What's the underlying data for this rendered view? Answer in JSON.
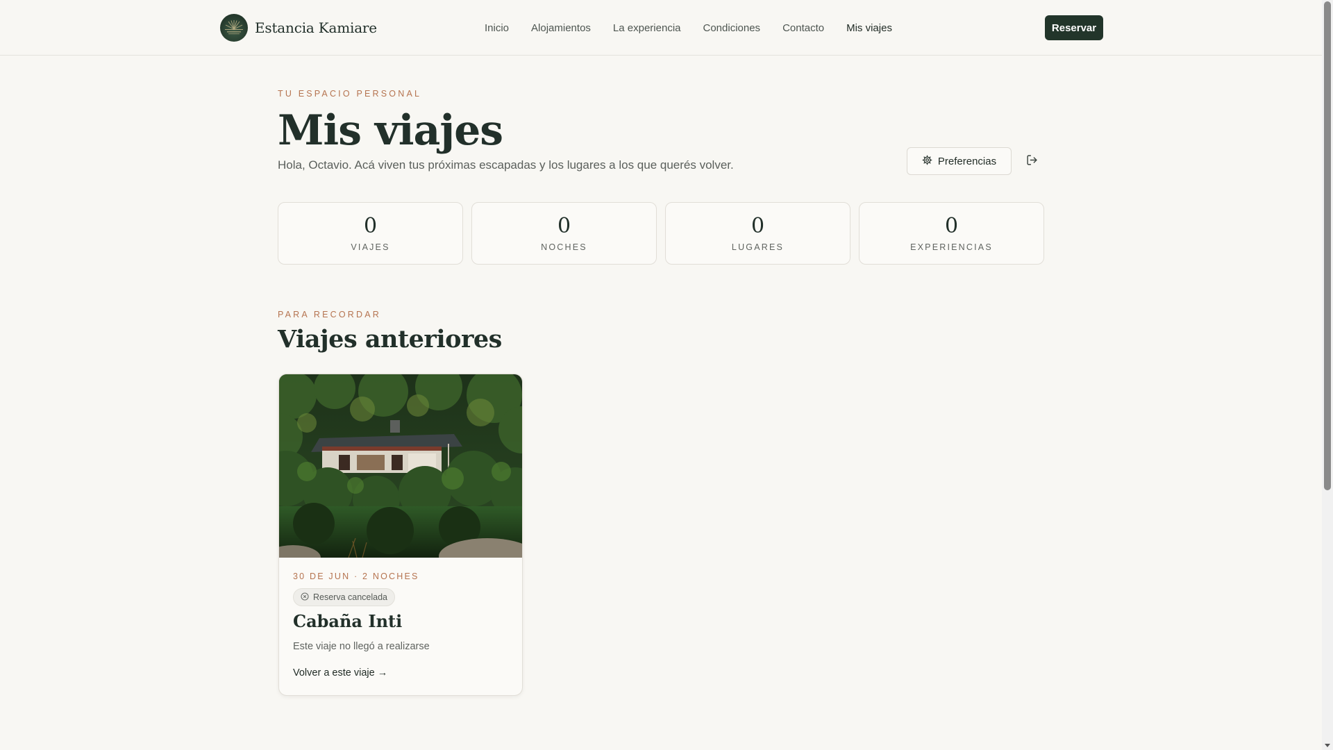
{
  "brand": {
    "name": "Estancia Kamiare",
    "logo_icon": "sun-horizon-logo-icon"
  },
  "nav": {
    "items": [
      {
        "label": "Inicio"
      },
      {
        "label": "Alojamientos"
      },
      {
        "label": "La experiencia"
      },
      {
        "label": "Condiciones"
      },
      {
        "label": "Contacto"
      },
      {
        "label": "Mis viajes",
        "active": true
      }
    ],
    "cta_label": "Reservar"
  },
  "intro": {
    "eyebrow": "TU ESPACIO PERSONAL",
    "title": "Mis viajes",
    "greeting": "Hola, Octavio. Acá viven tus próximas escapadas y los lugares a los que querés volver.",
    "preferences_label": "Preferencias",
    "preferences_icon": "gear-icon",
    "logout_icon": "logout-icon"
  },
  "stats": [
    {
      "value": "0",
      "label": "VIAJES"
    },
    {
      "value": "0",
      "label": "NOCHES"
    },
    {
      "value": "0",
      "label": "LUGARES"
    },
    {
      "value": "0",
      "label": "EXPERIENCIAS"
    }
  ],
  "past_trips": {
    "eyebrow": "PARA RECORDAR",
    "title": "Viajes anteriores",
    "cards": [
      {
        "meta": "30 DE JUN · 2 NOCHES",
        "status": "Reserva cancelada",
        "status_icon": "x-circle-icon",
        "name": "Cabaña Inti",
        "description": "Este viaje no llegó a realizarse",
        "link_label": "Volver a este viaje →"
      }
    ]
  },
  "colors": {
    "background": "#f8f7f3",
    "primary": "#22352a",
    "accent": "#b5734f",
    "text": "#1f2a24"
  }
}
